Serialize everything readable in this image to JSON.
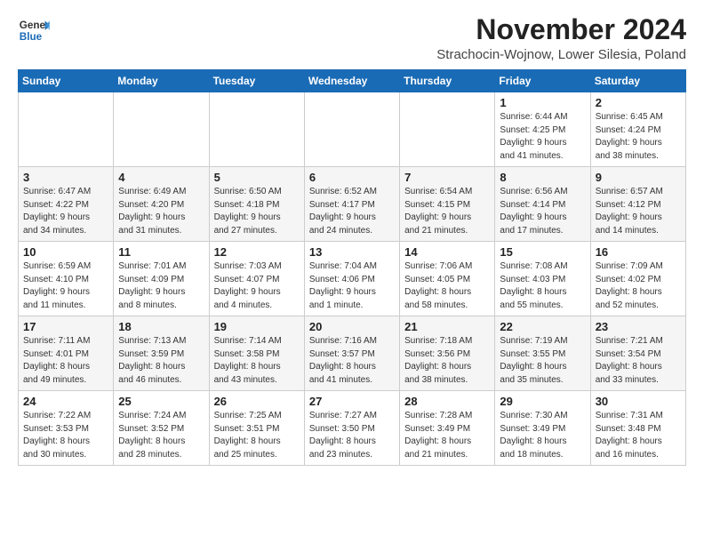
{
  "logo": {
    "line1": "General",
    "line2": "Blue"
  },
  "header": {
    "month": "November 2024",
    "location": "Strachocin-Wojnow, Lower Silesia, Poland"
  },
  "weekdays": [
    "Sunday",
    "Monday",
    "Tuesday",
    "Wednesday",
    "Thursday",
    "Friday",
    "Saturday"
  ],
  "weeks": [
    [
      {
        "day": "",
        "info": ""
      },
      {
        "day": "",
        "info": ""
      },
      {
        "day": "",
        "info": ""
      },
      {
        "day": "",
        "info": ""
      },
      {
        "day": "",
        "info": ""
      },
      {
        "day": "1",
        "info": "Sunrise: 6:44 AM\nSunset: 4:25 PM\nDaylight: 9 hours\nand 41 minutes."
      },
      {
        "day": "2",
        "info": "Sunrise: 6:45 AM\nSunset: 4:24 PM\nDaylight: 9 hours\nand 38 minutes."
      }
    ],
    [
      {
        "day": "3",
        "info": "Sunrise: 6:47 AM\nSunset: 4:22 PM\nDaylight: 9 hours\nand 34 minutes."
      },
      {
        "day": "4",
        "info": "Sunrise: 6:49 AM\nSunset: 4:20 PM\nDaylight: 9 hours\nand 31 minutes."
      },
      {
        "day": "5",
        "info": "Sunrise: 6:50 AM\nSunset: 4:18 PM\nDaylight: 9 hours\nand 27 minutes."
      },
      {
        "day": "6",
        "info": "Sunrise: 6:52 AM\nSunset: 4:17 PM\nDaylight: 9 hours\nand 24 minutes."
      },
      {
        "day": "7",
        "info": "Sunrise: 6:54 AM\nSunset: 4:15 PM\nDaylight: 9 hours\nand 21 minutes."
      },
      {
        "day": "8",
        "info": "Sunrise: 6:56 AM\nSunset: 4:14 PM\nDaylight: 9 hours\nand 17 minutes."
      },
      {
        "day": "9",
        "info": "Sunrise: 6:57 AM\nSunset: 4:12 PM\nDaylight: 9 hours\nand 14 minutes."
      }
    ],
    [
      {
        "day": "10",
        "info": "Sunrise: 6:59 AM\nSunset: 4:10 PM\nDaylight: 9 hours\nand 11 minutes."
      },
      {
        "day": "11",
        "info": "Sunrise: 7:01 AM\nSunset: 4:09 PM\nDaylight: 9 hours\nand 8 minutes."
      },
      {
        "day": "12",
        "info": "Sunrise: 7:03 AM\nSunset: 4:07 PM\nDaylight: 9 hours\nand 4 minutes."
      },
      {
        "day": "13",
        "info": "Sunrise: 7:04 AM\nSunset: 4:06 PM\nDaylight: 9 hours\nand 1 minute."
      },
      {
        "day": "14",
        "info": "Sunrise: 7:06 AM\nSunset: 4:05 PM\nDaylight: 8 hours\nand 58 minutes."
      },
      {
        "day": "15",
        "info": "Sunrise: 7:08 AM\nSunset: 4:03 PM\nDaylight: 8 hours\nand 55 minutes."
      },
      {
        "day": "16",
        "info": "Sunrise: 7:09 AM\nSunset: 4:02 PM\nDaylight: 8 hours\nand 52 minutes."
      }
    ],
    [
      {
        "day": "17",
        "info": "Sunrise: 7:11 AM\nSunset: 4:01 PM\nDaylight: 8 hours\nand 49 minutes."
      },
      {
        "day": "18",
        "info": "Sunrise: 7:13 AM\nSunset: 3:59 PM\nDaylight: 8 hours\nand 46 minutes."
      },
      {
        "day": "19",
        "info": "Sunrise: 7:14 AM\nSunset: 3:58 PM\nDaylight: 8 hours\nand 43 minutes."
      },
      {
        "day": "20",
        "info": "Sunrise: 7:16 AM\nSunset: 3:57 PM\nDaylight: 8 hours\nand 41 minutes."
      },
      {
        "day": "21",
        "info": "Sunrise: 7:18 AM\nSunset: 3:56 PM\nDaylight: 8 hours\nand 38 minutes."
      },
      {
        "day": "22",
        "info": "Sunrise: 7:19 AM\nSunset: 3:55 PM\nDaylight: 8 hours\nand 35 minutes."
      },
      {
        "day": "23",
        "info": "Sunrise: 7:21 AM\nSunset: 3:54 PM\nDaylight: 8 hours\nand 33 minutes."
      }
    ],
    [
      {
        "day": "24",
        "info": "Sunrise: 7:22 AM\nSunset: 3:53 PM\nDaylight: 8 hours\nand 30 minutes."
      },
      {
        "day": "25",
        "info": "Sunrise: 7:24 AM\nSunset: 3:52 PM\nDaylight: 8 hours\nand 28 minutes."
      },
      {
        "day": "26",
        "info": "Sunrise: 7:25 AM\nSunset: 3:51 PM\nDaylight: 8 hours\nand 25 minutes."
      },
      {
        "day": "27",
        "info": "Sunrise: 7:27 AM\nSunset: 3:50 PM\nDaylight: 8 hours\nand 23 minutes."
      },
      {
        "day": "28",
        "info": "Sunrise: 7:28 AM\nSunset: 3:49 PM\nDaylight: 8 hours\nand 21 minutes."
      },
      {
        "day": "29",
        "info": "Sunrise: 7:30 AM\nSunset: 3:49 PM\nDaylight: 8 hours\nand 18 minutes."
      },
      {
        "day": "30",
        "info": "Sunrise: 7:31 AM\nSunset: 3:48 PM\nDaylight: 8 hours\nand 16 minutes."
      }
    ]
  ]
}
